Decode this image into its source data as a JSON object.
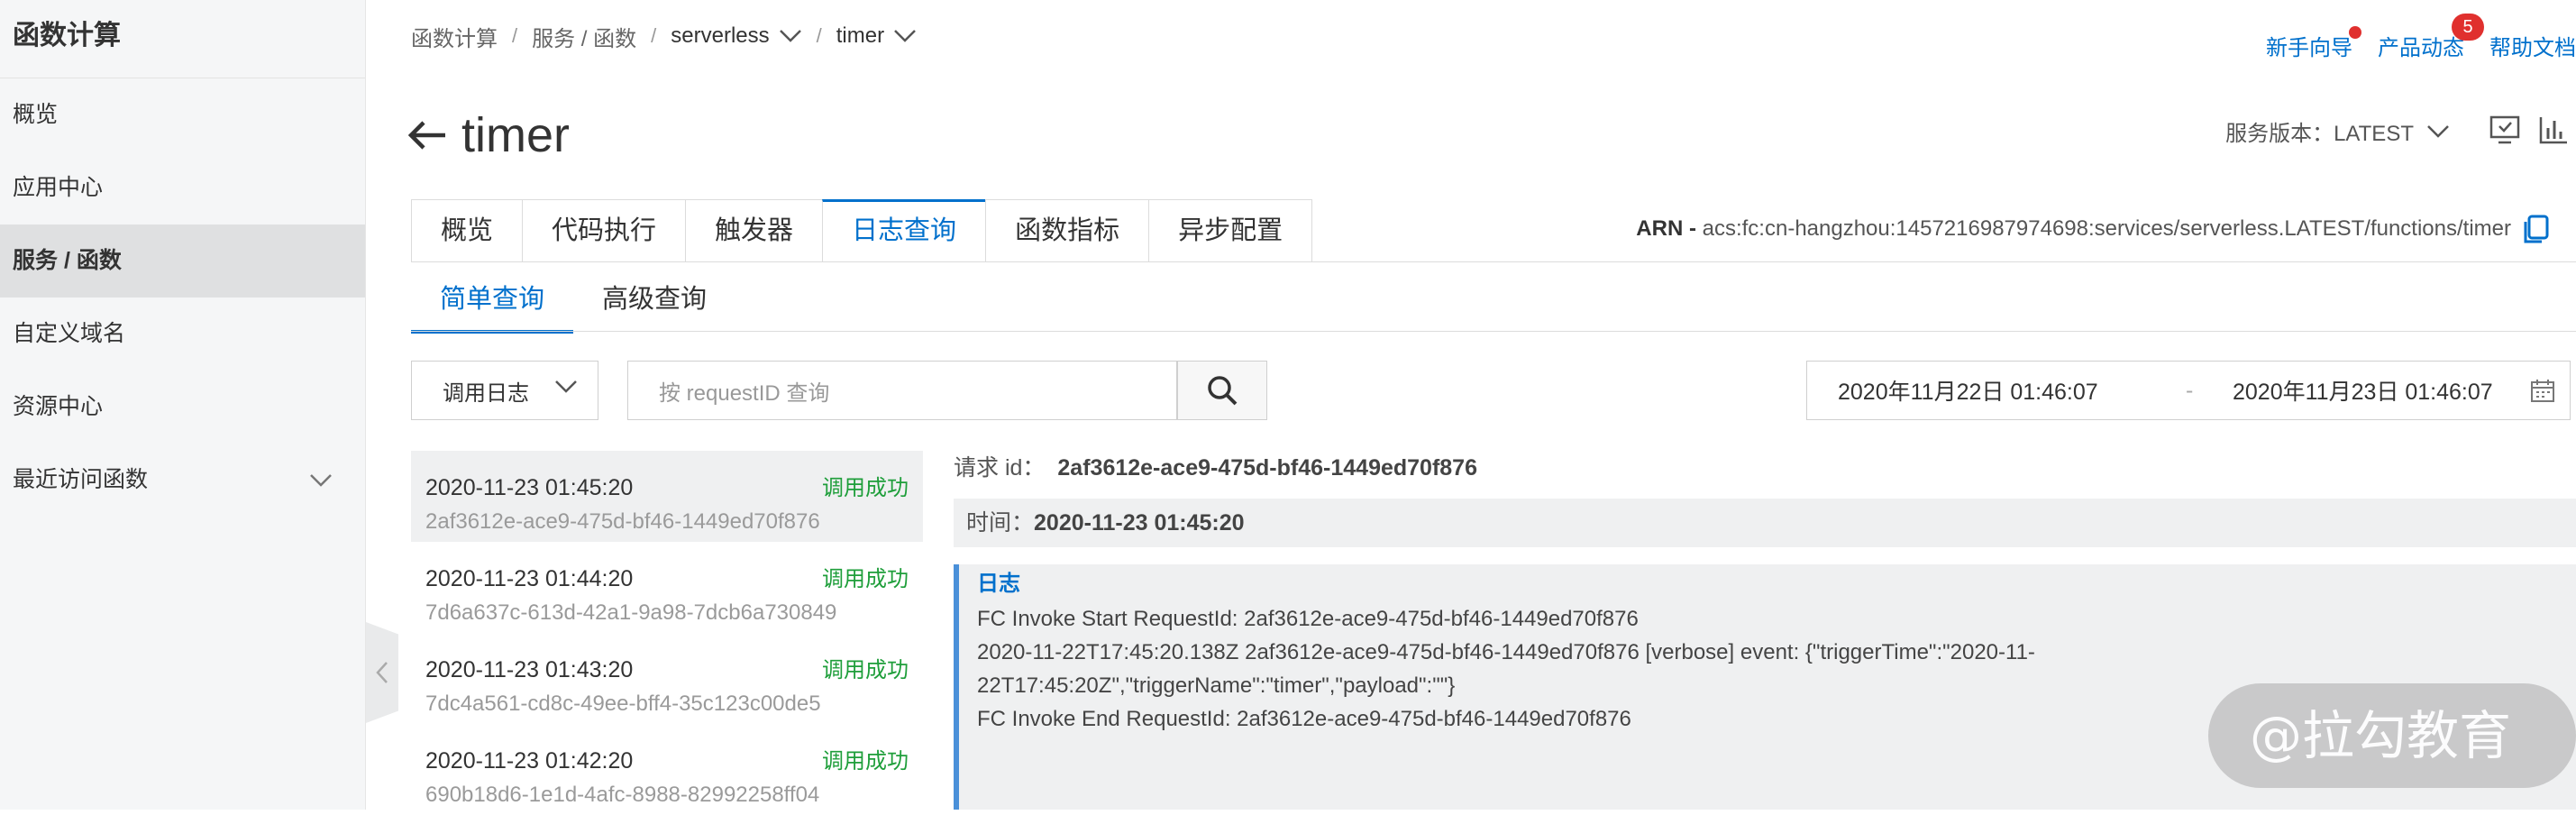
{
  "sidebar": {
    "title": "函数计算",
    "items": [
      {
        "label": "概览",
        "active": false
      },
      {
        "label": "应用中心",
        "active": false
      },
      {
        "label": "服务 / 函数",
        "active": true
      },
      {
        "label": "自定义域名",
        "active": false
      },
      {
        "label": "资源中心",
        "active": false
      },
      {
        "label": "最近访问函数",
        "active": false
      }
    ]
  },
  "breadcrumb": [
    "函数计算",
    "服务 / 函数",
    "serverless",
    "timer"
  ],
  "breadcrumb_sep": "/",
  "top_links": {
    "guide": "新手向导",
    "news": "产品动态",
    "news_badge": "5",
    "docs": "帮助文档"
  },
  "page": {
    "title": "timer",
    "version_label": "服务版本：LATEST"
  },
  "tabs": [
    "概览",
    "代码执行",
    "触发器",
    "日志查询",
    "函数指标",
    "异步配置"
  ],
  "active_tab": 3,
  "arn": {
    "label": "ARN -",
    "value": "acs:fc:cn-hangzhou:1457216987974698:services/serverless.LATEST/functions/timer"
  },
  "subtabs": [
    "简单查询",
    "高级查询"
  ],
  "query": {
    "log_type": "调用日志",
    "search_placeholder": "按 requestID 查询",
    "date_start": "2020年11月22日 01:46:07",
    "date_sep": "-",
    "date_end": "2020年11月23日 01:46:07"
  },
  "invocations": [
    {
      "time": "2020-11-23 01:45:20",
      "status": "调用成功",
      "id": "2af3612e-ace9-475d-bf46-1449ed70f876"
    },
    {
      "time": "2020-11-23 01:44:20",
      "status": "调用成功",
      "id": "7d6a637c-613d-42a1-9a98-7dcb6a730849"
    },
    {
      "time": "2020-11-23 01:43:20",
      "status": "调用成功",
      "id": "7dc4a561-cd8c-49ee-bff4-35c123c00de5"
    },
    {
      "time": "2020-11-23 01:42:20",
      "status": "调用成功",
      "id": "690b18d6-1e1d-4afc-8988-82992258ff04"
    }
  ],
  "detail": {
    "request_label": "请求 id：",
    "request_id": "2af3612e-ace9-475d-bf46-1449ed70f876",
    "time_label": "时间：",
    "time": "2020-11-23 01:45:20",
    "log_title": "日志",
    "log_lines": [
      "FC Invoke Start RequestId: 2af3612e-ace9-475d-bf46-1449ed70f876",
      "2020-11-22T17:45:20.138Z 2af3612e-ace9-475d-bf46-1449ed70f876 [verbose] event: {\"triggerTime\":\"2020-11-",
      "22T17:45:20Z\",\"triggerName\":\"timer\",\"payload\":\"\"}",
      "FC Invoke End RequestId: 2af3612e-ace9-475d-bf46-1449ed70f876"
    ]
  },
  "watermark": "@拉勾教育",
  "colors": {
    "accent": "#0070cc",
    "success": "#1e9e3a",
    "badge": "#e0302e"
  }
}
